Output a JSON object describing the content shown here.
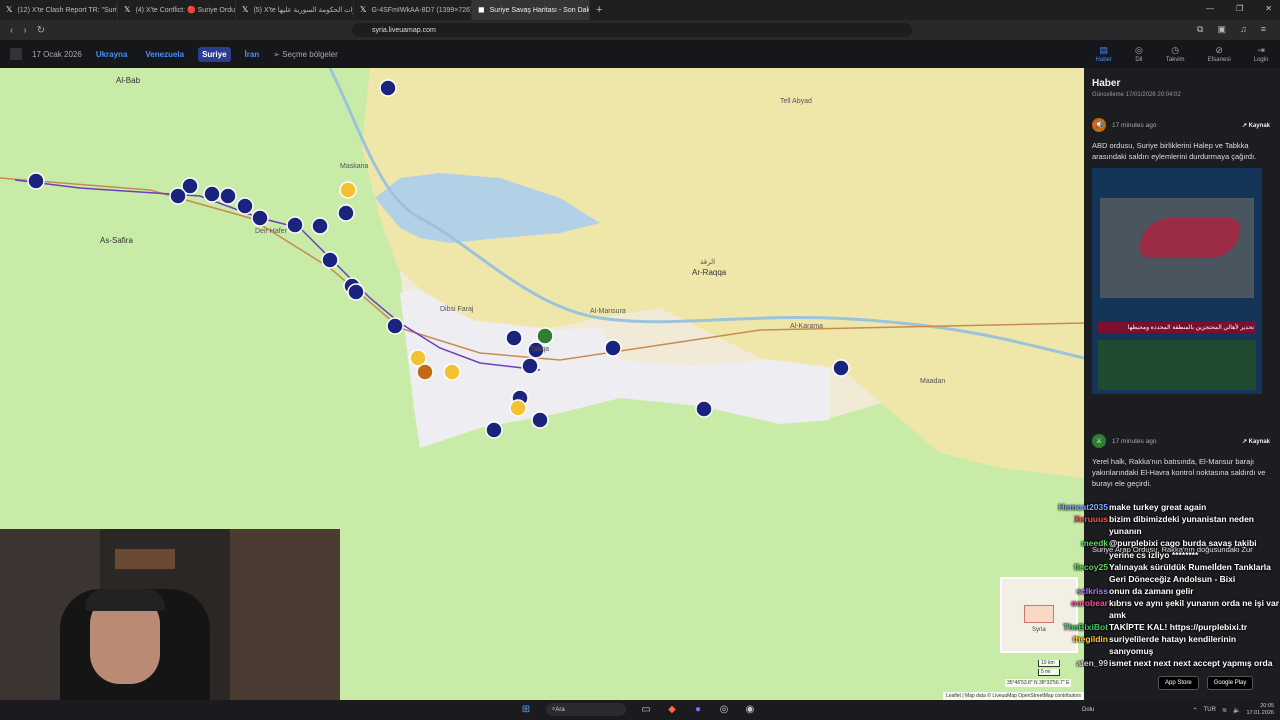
{
  "browser": {
    "tabs": [
      {
        "label": "(12) X'te Clash Report TR: \"Suriye ord",
        "icon": "x-logo-icon",
        "active": false
      },
      {
        "label": "(4) X'te Conflict: 🔴 Suriye Ordusu",
        "icon": "x-logo-icon",
        "active": false
      },
      {
        "label": "(5) X'te قوات الحكومة السورية عليها",
        "icon": "x-logo-icon",
        "active": false
      },
      {
        "label": "G-4SFmIWkAA-8D7 (1399×726)",
        "icon": "x-logo-icon",
        "active": false
      },
      {
        "label": "Suriye Savaş Haritası - Son Dakik",
        "icon": "liveuamap-icon",
        "active": true
      }
    ],
    "url": "syria.liveuamap.com"
  },
  "site": {
    "date": "17 Ocak 2026",
    "regions": [
      "Ukrayna",
      "Venezuela",
      "Suriye",
      "İran"
    ],
    "active_region": "Suriye",
    "select_regions": "Seçme bölgeler",
    "right_nav": [
      "Haber",
      "Dil",
      "Takvim",
      "Efsanesi",
      "Login"
    ]
  },
  "map": {
    "labels": [
      {
        "text": "Al-Bab",
        "cls": "city"
      },
      {
        "text": "As-Safira",
        "cls": "city"
      },
      {
        "text": "Ar-Raqqa",
        "cls": "city"
      },
      {
        "text": "الرقة",
        "cls": ""
      },
      {
        "text": "Dibsi Faraj",
        "cls": ""
      },
      {
        "text": "Tabqa",
        "cls": ""
      },
      {
        "text": "Maadan",
        "cls": ""
      },
      {
        "text": "Al-Mansura",
        "cls": ""
      },
      {
        "text": "Al-Karama",
        "cls": ""
      },
      {
        "text": "Deir Hafer",
        "cls": ""
      },
      {
        "text": "Maskana",
        "cls": ""
      },
      {
        "text": "Tell Abyad",
        "cls": ""
      }
    ],
    "attribution": "Leaflet | Map data © LiveuaMap OpenStreetMap contributors",
    "minimap_label": "Syria",
    "scale_km": "10 km",
    "scale_mi": "5 mi",
    "coords": "35°46'53.8\" N 38°32'56.7\" E"
  },
  "news": {
    "title": "Haber",
    "updated": "Güncelleme 17/01/2026 20:04:02",
    "items": [
      {
        "time": "17 minutes ago",
        "source": "Kaynak",
        "text": "ABD ordusu, Suriye birliklerini Halep ve Tabkka arasındaki saldırı eylemlerini durdurmaya çağırdı.",
        "image_caption": "تحذير لأهالي المحتجزين بالمنطقة المحددة ومحيطها"
      },
      {
        "time": "17 minutes ago",
        "source": "Kaynak",
        "text": "Yerel halk, Rakka'nın batısında, El-Mansur barajı yakınlarındaki El-Havra kontrol noktasına saldırdı ve burayı ele geçirdi."
      },
      {
        "time": "",
        "source": "",
        "text": "Suriye Arap Ordusu, Rakka'nın doğusundaki Zur"
      }
    ]
  },
  "chat": [
    {
      "user": "Hemcat2035",
      "color": "#7aa7ff",
      "msg": "make turkey great again"
    },
    {
      "user": "Xeruuus",
      "color": "#ff4d4d",
      "msg": "bizim dibimizdeki yunanistan neden yunanın"
    },
    {
      "user": "meedk",
      "color": "#5cd65c",
      "msg": "@purplebixi cago burda savaş takibi yerine cs izliyo ********"
    },
    {
      "user": "flecoy25",
      "color": "#5cd65c",
      "msg": "Yalınayak sürüldük Rumelİden Tanklarla Geri Döneceğiz Andolsun - Bixi"
    },
    {
      "user": "sclkriss",
      "color": "#b57cff",
      "msg": "onun da zamanı gelir"
    },
    {
      "user": "ourobear",
      "color": "#ff4d9a",
      "msg": "kıbrıs ve aynı şekil yunanın orda ne işi var amk"
    },
    {
      "user": "TheBixiBot",
      "color": "#44c767",
      "msg": "TAKİPTE KAL! https://purplebixi.tr"
    },
    {
      "user": "thegildin",
      "color": "#ffcc33",
      "msg": "suriyelilerde hatayı kendilerinin sanıyomuş"
    },
    {
      "user": "aten_99",
      "color": "#cccccc",
      "msg": "ismet next next next accept yapmış orda"
    }
  ],
  "taskbar": {
    "weather": "Dolu",
    "search": "Ara",
    "stores": [
      "App Store",
      "Google Play"
    ],
    "lang": "TUR",
    "time": "20:05",
    "date": "17.01.2026"
  },
  "colors": {
    "map_green": "#c9eba8",
    "sdf_yellow": "#efe7a9",
    "contested_white": "#eeeef2",
    "lake_blue": "#b3d1e6",
    "accent_blue": "#4a8cff",
    "marker_navy": "#1a237e"
  }
}
